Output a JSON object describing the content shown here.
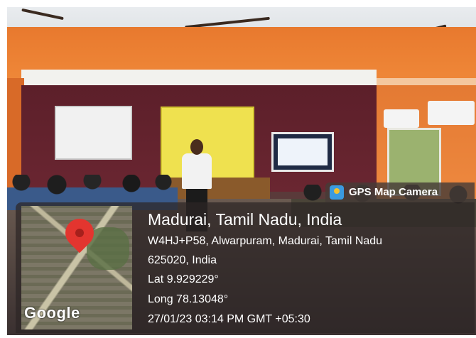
{
  "badge": {
    "label": "GPS Map Camera",
    "icon": "gps-camera-icon"
  },
  "map": {
    "logo_text": "Google",
    "marker": "location-pin-icon"
  },
  "location": {
    "title": "Madurai, Tamil Nadu, India",
    "address_line1": "W4HJ+P58, Alwarpuram, Madurai, Tamil Nadu",
    "address_line2": "625020, India",
    "lat": "Lat 9.929229°",
    "long": "Long 78.13048°",
    "datetime": "27/01/23 03:14 PM GMT +05:30"
  }
}
